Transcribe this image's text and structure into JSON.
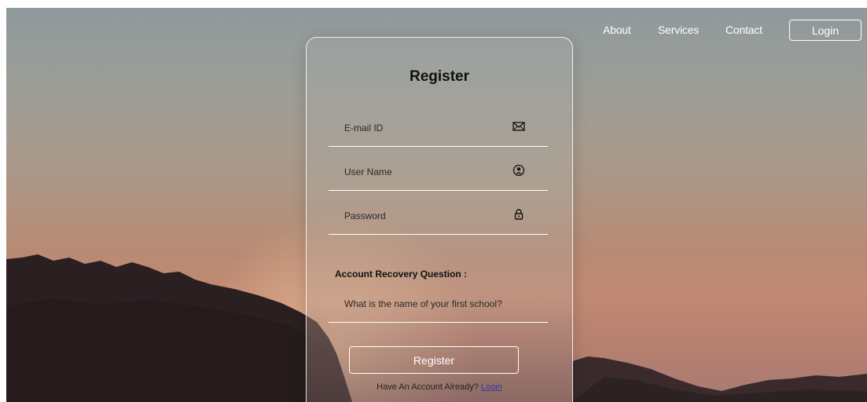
{
  "nav": {
    "about": "About",
    "services": "Services",
    "contact": "Contact",
    "login": "Login"
  },
  "form": {
    "title": "Register",
    "email_placeholder": "E-mail ID",
    "email_icon": "envelope-icon",
    "username_placeholder": "User Name",
    "username_icon": "user-circle-icon",
    "password_placeholder": "Password",
    "password_icon": "lock-icon",
    "recovery_label": "Account Recovery Question :",
    "recovery_placeholder": "What is the name of your first school?",
    "register_button": "Register",
    "have_account_text": "Have An Account Already?",
    "login_link": "Login"
  },
  "colors": {
    "text_dark": "#111111",
    "nav_text": "#ffffff",
    "link": "#3a3aa0"
  }
}
